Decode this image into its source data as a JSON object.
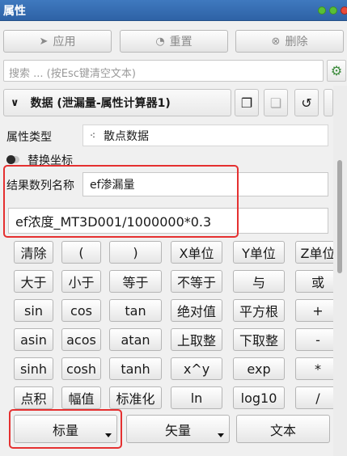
{
  "window": {
    "title": "属性"
  },
  "toolbar": {
    "apply": {
      "label": "应用",
      "icon": "send-icon"
    },
    "reset": {
      "label": "重置",
      "icon": "gauge-icon"
    },
    "delete": {
      "label": "删除",
      "icon": "close-circle-icon"
    }
  },
  "search": {
    "placeholder": "搜索 ... (按Esc键清空文本)"
  },
  "section": {
    "title": "数据 (泄漏量-属性计算器1)"
  },
  "properties": {
    "type_label": "属性类型",
    "type_value": "散点数据",
    "replace_coords_label": "替换坐标",
    "result_name_label": "结果数列名称",
    "result_name_value": "ef渗漏量",
    "expression": "ef浓度_MT3D001/1000000*0.3"
  },
  "keypad": [
    [
      "清除",
      "(",
      ")",
      "X单位",
      "Y单位",
      "Z单位"
    ],
    [
      "大于",
      "小于",
      "等于",
      "不等于",
      "与",
      "或"
    ],
    [
      "sin",
      "cos",
      "tan",
      "绝对值",
      "平方根",
      "+"
    ],
    [
      "asin",
      "acos",
      "atan",
      "上取整",
      "下取整",
      "-"
    ],
    [
      "sinh",
      "cosh",
      "tanh",
      "x^y",
      "exp",
      "*"
    ],
    [
      "点积",
      "幅值",
      "标准化",
      "ln",
      "log10",
      "/"
    ]
  ],
  "bottom_buttons": {
    "scalar": "标量",
    "vector": "矢量",
    "text": "文本"
  },
  "colors": {
    "titlebar": "#3f79bf",
    "highlight": "#e53030"
  }
}
